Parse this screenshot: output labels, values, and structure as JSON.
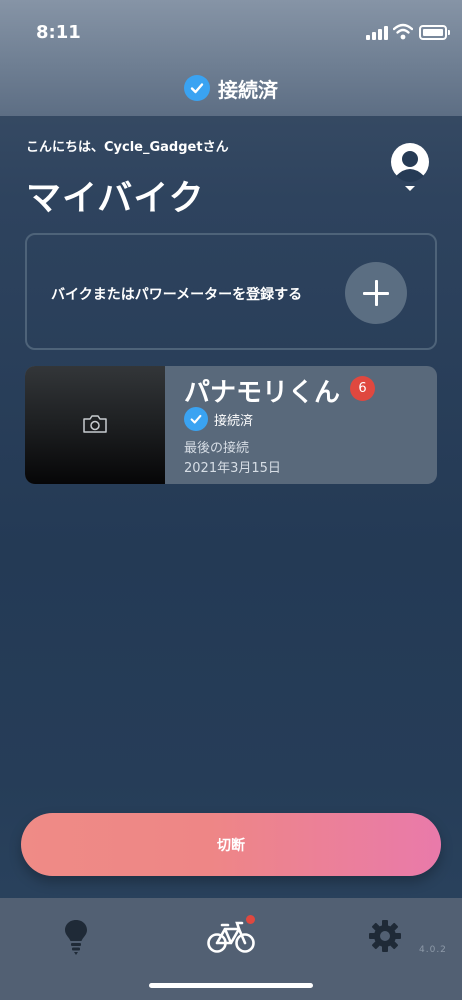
{
  "status_bar": {
    "time": "8:11"
  },
  "header": {
    "connection_status": "接続済"
  },
  "greeting": "こんにちは、Cycle_Gadgetさん",
  "page_title": "マイバイク",
  "register_card": {
    "label": "バイクまたはパワーメーターを登録する"
  },
  "bike": {
    "name": "パナモリくん",
    "badge_count": "6",
    "status": "接続済",
    "last_connection_label": "最後の接続",
    "last_connection_date": "2021年3月15日"
  },
  "disconnect_button": {
    "label": "切断"
  },
  "tab_bar": {
    "tabs": [
      {
        "icon": "lightbulb-icon"
      },
      {
        "icon": "bicycle-icon",
        "active": true,
        "notification_dot": true
      },
      {
        "icon": "gear-icon"
      }
    ]
  },
  "version": "4.0.2",
  "colors": {
    "accent_check": "#3aa3f2",
    "badge": "#e0483f",
    "disconnect_gradient_start": "#ef8b86",
    "disconnect_gradient_end": "#e97aaa"
  }
}
